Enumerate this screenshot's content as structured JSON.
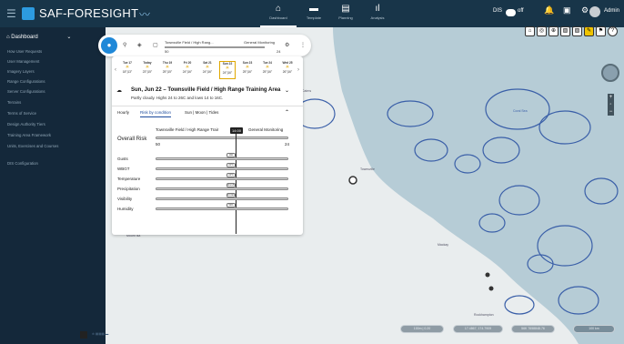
{
  "app": {
    "title": "SAF-FORESIGHT"
  },
  "nav": [
    {
      "label": "Dashboard"
    },
    {
      "label": "Template"
    },
    {
      "label": "Planning"
    },
    {
      "label": "Analysis"
    }
  ],
  "topright": {
    "dis": "DIS",
    "toggle": "off",
    "user": "Admin"
  },
  "sidebar": {
    "header": "Dashboard",
    "items": [
      "How User Requests",
      "User Management",
      "Imagery Layers",
      "Range Configurations",
      "Server Configurations",
      "Terrains",
      "Terms of Service",
      "Design Authority Tiers",
      "Training Area Framework",
      "Units, Exercises and Courses",
      "DIS Configuration"
    ]
  },
  "toolbar": {
    "slider_label": "Townsville Field / High Rang...",
    "slider_value_a": "50",
    "slider_value_b": "24",
    "general": "General Monitoring"
  },
  "days": [
    {
      "d": "Tue 17",
      "t": "18°|13°"
    },
    {
      "d": "Today",
      "t": "23°|15°"
    },
    {
      "d": "Thu 19",
      "t": "25°|15°"
    },
    {
      "d": "Fri 20",
      "t": "24°|16°"
    },
    {
      "d": "Sat 21",
      "t": "24°|16°"
    },
    {
      "d": "Sun 22",
      "t": "24°|16°"
    },
    {
      "d": "Sun 23",
      "t": "25°|16°"
    },
    {
      "d": "Tue 24",
      "t": "25°|16°"
    },
    {
      "d": "Wed 25",
      "t": "26°|16°"
    }
  ],
  "summary": {
    "title": "Sun, Jun 22 – Townsville Field / High Range Training Area",
    "desc": "Partly cloudy. Highs 24 to 26C and lows 14 to 16C."
  },
  "tabs": [
    "Hourly",
    "Risk by condition",
    "Sun | Moon | Tides"
  ],
  "risk": {
    "location": "Townsville Field / High Range Trair",
    "time": "14:00",
    "general": "General Monitoring",
    "overall": "Overall Risk",
    "min": "50",
    "max": "24"
  },
  "conditions": [
    {
      "name": "Gusts",
      "value": "14kt"
    },
    {
      "name": "WBGT",
      "value": "22°C"
    },
    {
      "name": "Temperature",
      "value": "24°C"
    },
    {
      "name": "Precipitation",
      "value": "0mm/h"
    },
    {
      "name": "Visibility",
      "value": "10.0km"
    },
    {
      "name": "Humidity",
      "value": "50%"
    }
  ],
  "map": {
    "places": [
      "Cairns",
      "Townsville",
      "Mackay",
      "Rockhampton",
      "Mount Isa",
      "Coral Sea"
    ]
  },
  "bottom": {
    "a": "100m | 0.20",
    "b": "17.4867, 174.7909",
    "c": "56K 7658848.76",
    "scale": "100 km"
  },
  "colors": {
    "topbar": "#183549",
    "sidebar": "#14283a",
    "accent": "#2d9be0",
    "land": "#e9edee",
    "sea": "#b6ccd6"
  }
}
